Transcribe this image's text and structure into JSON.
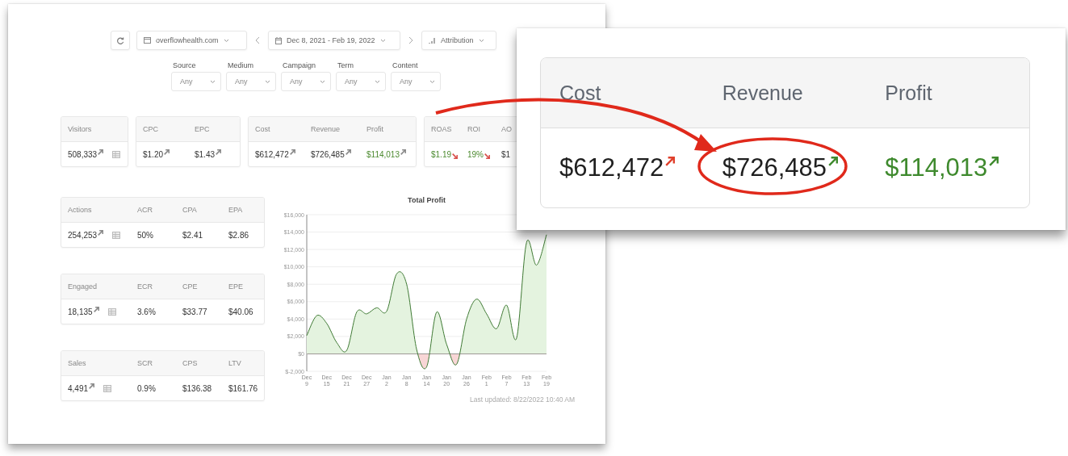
{
  "toolbar": {
    "site": "overflowhealth.com",
    "date_range": "Dec 8, 2021 - Feb 19, 2022",
    "attribution": "Attribution"
  },
  "filters": [
    {
      "label": "Source",
      "value": "Any"
    },
    {
      "label": "Medium",
      "value": "Any"
    },
    {
      "label": "Campaign",
      "value": "Any"
    },
    {
      "label": "Term",
      "value": "Any"
    },
    {
      "label": "Content",
      "value": "Any"
    }
  ],
  "metric_cards": [
    {
      "table_icon": true,
      "metrics": [
        {
          "label": "Visitors",
          "value": "508,333",
          "rising": true,
          "color": "#8c8c8c",
          "positive": false
        }
      ]
    },
    {
      "table_icon": false,
      "metrics": [
        {
          "label": "CPC",
          "value": "$1.20",
          "rising": true,
          "color": "#8c8c8c",
          "positive": false
        },
        {
          "label": "EPC",
          "value": "$1.43",
          "rising": true,
          "color": "#8c8c8c",
          "positive": false
        }
      ]
    },
    {
      "table_icon": false,
      "metrics": [
        {
          "label": "Cost",
          "value": "$612,472",
          "rising": true,
          "color": "#8c8c8c",
          "positive": false
        },
        {
          "label": "Revenue",
          "value": "$726,485",
          "rising": true,
          "color": "#8c8c8c",
          "positive": false
        },
        {
          "label": "Profit",
          "value": "$114,013",
          "rising": true,
          "color": "#8c8c8c",
          "positive": true
        }
      ]
    },
    {
      "table_icon": false,
      "metrics": [
        {
          "label": "ROAS",
          "value": "$1.19",
          "rising": false,
          "color": "#d9534f",
          "positive": true
        },
        {
          "label": "ROI",
          "value": "19%",
          "rising": false,
          "color": "#d9534f",
          "positive": true
        },
        {
          "label": "AO",
          "value": "$1",
          "positive": false
        }
      ]
    }
  ],
  "side_cards": [
    {
      "table_icon": true,
      "metrics": [
        {
          "label": "Actions",
          "value": "254,253",
          "rising": true,
          "color": "#8c8c8c"
        },
        {
          "label": "ACR",
          "value": "50%"
        },
        {
          "label": "CPA",
          "value": "$2.41"
        },
        {
          "label": "EPA",
          "value": "$2.86"
        }
      ]
    },
    {
      "table_icon": true,
      "metrics": [
        {
          "label": "Engaged",
          "value": "18,135",
          "rising": true,
          "color": "#8c8c8c"
        },
        {
          "label": "ECR",
          "value": "3.6%"
        },
        {
          "label": "CPE",
          "value": "$33.77"
        },
        {
          "label": "EPE",
          "value": "$40.06"
        }
      ]
    },
    {
      "table_icon": true,
      "metrics": [
        {
          "label": "Sales",
          "value": "4,491",
          "rising": true,
          "color": "#8c8c8c"
        },
        {
          "label": "SCR",
          "value": "0.9%"
        },
        {
          "label": "CPS",
          "value": "$136.38"
        },
        {
          "label": "LTV",
          "value": "$161.76"
        }
      ]
    }
  ],
  "chart": {
    "chart_data": {
      "type": "area",
      "title": "Total Profit",
      "grid": true,
      "categories": [
        "Dec 9",
        null,
        "Dec 15",
        null,
        "Dec 21",
        null,
        "Dec 27",
        null,
        "Jan 2",
        null,
        "Jan 8",
        null,
        "Jan 14",
        null,
        "Jan 20",
        null,
        "Jan 26",
        null,
        "Feb 1",
        null,
        "Feb 7",
        null,
        "Feb 13",
        null,
        "Feb 19"
      ],
      "series": [
        {
          "color": "#3f7a34",
          "values": [
            2100,
            4400,
            3500,
            1300,
            400,
            4800,
            4600,
            5300,
            4900,
            9200,
            8000,
            500,
            -1500,
            4800,
            1100,
            -1200,
            4000,
            6300,
            4600,
            2900,
            5600,
            1800,
            12800,
            10200,
            13700
          ]
        }
      ],
      "ylim": [
        -2000,
        16000
      ],
      "yticks": [
        {
          "value": -2000,
          "label": "$-2,000"
        },
        {
          "value": 0,
          "label": "$0"
        },
        {
          "value": 2000,
          "label": "$2,000"
        },
        {
          "value": 4000,
          "label": "$4,000"
        },
        {
          "value": 6000,
          "label": "$6,000"
        },
        {
          "value": 8000,
          "label": "$8,000"
        },
        {
          "value": 10000,
          "label": "$10,000"
        },
        {
          "value": 12000,
          "label": "$12,000"
        },
        {
          "value": 14000,
          "label": "$14,000"
        },
        {
          "value": 16000,
          "label": "$16,000"
        }
      ]
    }
  },
  "last_updated": "Last updated: 8/22/2022 10:40 AM",
  "callout": {
    "metrics": [
      {
        "label": "Cost",
        "value": "$612,472",
        "rising": true,
        "color": "#e0402c",
        "positive": false,
        "circled": false
      },
      {
        "label": "Revenue",
        "value": "$726,485",
        "rising": true,
        "color": "#3f8a2e",
        "positive": false,
        "circled": true
      },
      {
        "label": "Profit",
        "value": "$114,013",
        "rising": true,
        "color": "#3f8a2e",
        "positive": true,
        "circled": false
      }
    ]
  }
}
